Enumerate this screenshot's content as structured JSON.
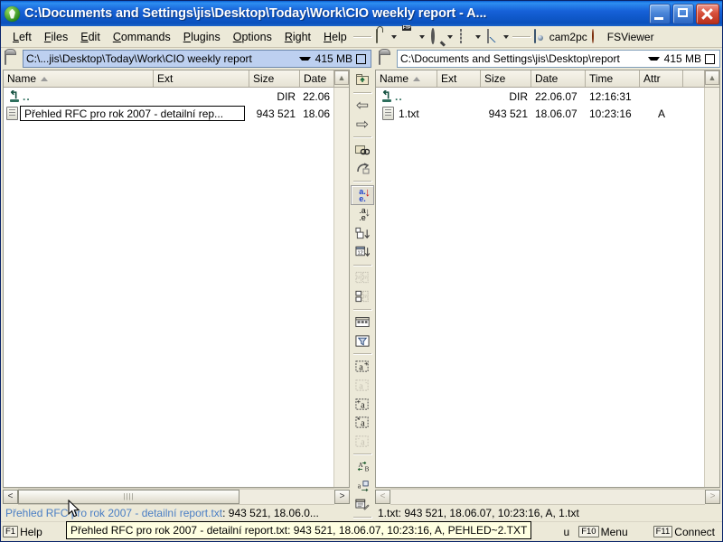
{
  "window": {
    "title": "C:\\Documents and Settings\\jis\\Desktop\\Today\\Work\\CIO weekly report - A...",
    "app_icon": "totalcommander-icon",
    "minimize_label": "Minimize",
    "maximize_label": "Maximize",
    "close_label": "Close"
  },
  "menubar": {
    "items": [
      {
        "label": "Left",
        "accel": "L"
      },
      {
        "label": "Files",
        "accel": "F"
      },
      {
        "label": "Edit",
        "accel": "E"
      },
      {
        "label": "Commands",
        "accel": "C"
      },
      {
        "label": "Plugins",
        "accel": "P"
      },
      {
        "label": "Options",
        "accel": "O"
      },
      {
        "label": "Right",
        "accel": "R"
      },
      {
        "label": "Help",
        "accel": "H"
      }
    ],
    "toolbuttons": [
      {
        "name": "lock-icon",
        "label": ""
      },
      {
        "name": "ftp-icon",
        "label": ""
      },
      {
        "name": "search-icon",
        "label": ""
      },
      {
        "name": "frame-icon",
        "label": ""
      },
      {
        "name": "chart-icon",
        "label": ""
      }
    ],
    "apps": [
      {
        "name": "cam2pc-icon",
        "label": "cam2pc"
      },
      {
        "name": "fsviewer-icon",
        "label": "FSViewer"
      }
    ]
  },
  "left_panel": {
    "drive_button": "drive-icon",
    "path": "C:\\...jis\\Desktop\\Today\\Work\\CIO weekly report",
    "free_space": "415 MB",
    "columns": [
      {
        "key": "name",
        "label": "Name",
        "sorted": true
      },
      {
        "key": "ext",
        "label": "Ext"
      },
      {
        "key": "size",
        "label": "Size"
      },
      {
        "key": "date",
        "label": "Date"
      }
    ],
    "rows": [
      {
        "icon": "up-folder-icon",
        "name": "..",
        "ext": "",
        "size": "DIR",
        "date": "22.06",
        "time": "",
        "attr": "",
        "selected": false,
        "parent": true
      },
      {
        "icon": "text-file-icon",
        "name": "Přehled RFC pro rok 2007 - detailní rep...",
        "ext": "",
        "size": "943 521",
        "date": "18.06",
        "time": "",
        "attr": "",
        "selected": true,
        "parent": false
      }
    ],
    "status": "Přehled RFC pro rok 2007 - detailní report.txt: 943 521, 18.06.0...",
    "status_highlight": "Přehled RFC pro rok 2007 - detailní report.txt",
    "status_rest": ": 943 521, 18.06.0...",
    "scroll_left_label": "<",
    "scroll_right_label": ">"
  },
  "right_panel": {
    "drive_button": "drive-icon",
    "path": "C:\\Documents and Settings\\jis\\Desktop\\report",
    "free_space": "415 MB",
    "columns": [
      {
        "key": "name",
        "label": "Name",
        "sorted": true
      },
      {
        "key": "ext",
        "label": "Ext"
      },
      {
        "key": "size",
        "label": "Size"
      },
      {
        "key": "date",
        "label": "Date"
      },
      {
        "key": "time",
        "label": "Time"
      },
      {
        "key": "attr",
        "label": "Attr"
      }
    ],
    "rows": [
      {
        "icon": "up-folder-icon",
        "name": "..",
        "ext": "",
        "size": "DIR",
        "date": "22.06.07",
        "time": "12:16:31",
        "attr": "",
        "selected": false,
        "parent": true
      },
      {
        "icon": "text-file-icon",
        "name": "1.txt",
        "ext": "",
        "size": "943 521",
        "date": "18.06.07",
        "time": "10:23:16",
        "attr": "A",
        "selected": false,
        "parent": false
      }
    ],
    "status": "1.txt: 943 521, 18.06.07, 10:23:16, A, 1.txt",
    "scroll_left_label": "<",
    "scroll_right_label": ">"
  },
  "mid_toolbar": {
    "buttons": [
      {
        "name": "up-folder-button",
        "glyph": "⬆",
        "state": "normal"
      },
      {
        "name": "back-button",
        "glyph": "⇦",
        "state": "normal"
      },
      {
        "name": "forward-button",
        "glyph": "⇨",
        "state": "normal"
      },
      {
        "name": "search-folder-button",
        "glyph": "🔍",
        "state": "normal"
      },
      {
        "name": "refresh-button",
        "glyph": "↷",
        "state": "normal"
      },
      {
        "name": "sort-by-name-button",
        "glyph": "a.e.↓",
        "state": "active"
      },
      {
        "name": "sort-by-ext-button",
        "glyph": ".a.e↓",
        "state": "normal"
      },
      {
        "name": "sort-by-size-button",
        "glyph": "□↓",
        "state": "normal"
      },
      {
        "name": "sort-by-date-button",
        "glyph": "12↓",
        "state": "normal"
      },
      {
        "name": "thumbnail-view-button",
        "glyph": "▤▤",
        "state": "disabled"
      },
      {
        "name": "brief-view-button",
        "glyph": "▦▤",
        "state": "normal"
      },
      {
        "name": "full-view-button",
        "glyph": "▤",
        "state": "normal"
      },
      {
        "name": "filter-button",
        "glyph": "▽",
        "state": "normal"
      },
      {
        "name": "select-group-button",
        "glyph": "a+",
        "state": "normal"
      },
      {
        "name": "unselect-group-button",
        "glyph": "a-",
        "state": "disabled"
      },
      {
        "name": "select-all-button",
        "glyph": "+a",
        "state": "normal"
      },
      {
        "name": "invert-selection-button",
        "glyph": "*a",
        "state": "normal"
      },
      {
        "name": "unselect-all-button",
        "glyph": "-a",
        "state": "disabled"
      },
      {
        "name": "compare-button",
        "glyph": "A⇄B",
        "state": "normal"
      },
      {
        "name": "sync-dirs-button",
        "glyph": "a⇄",
        "state": "normal"
      },
      {
        "name": "multi-rename-button",
        "glyph": "▤a",
        "state": "normal"
      }
    ]
  },
  "tooltip": {
    "text": "Přehled RFC pro rok 2007 - detailní report.txt: 943 521, 18.06.07, 10:23:16, A, PEHLED~2.TXT"
  },
  "function_keys": [
    {
      "key": "F1",
      "label": "Help"
    },
    {
      "key": "",
      "label": "u"
    },
    {
      "key": "F10",
      "label": "Menu"
    },
    {
      "key": "F11",
      "label": "Connect"
    }
  ]
}
